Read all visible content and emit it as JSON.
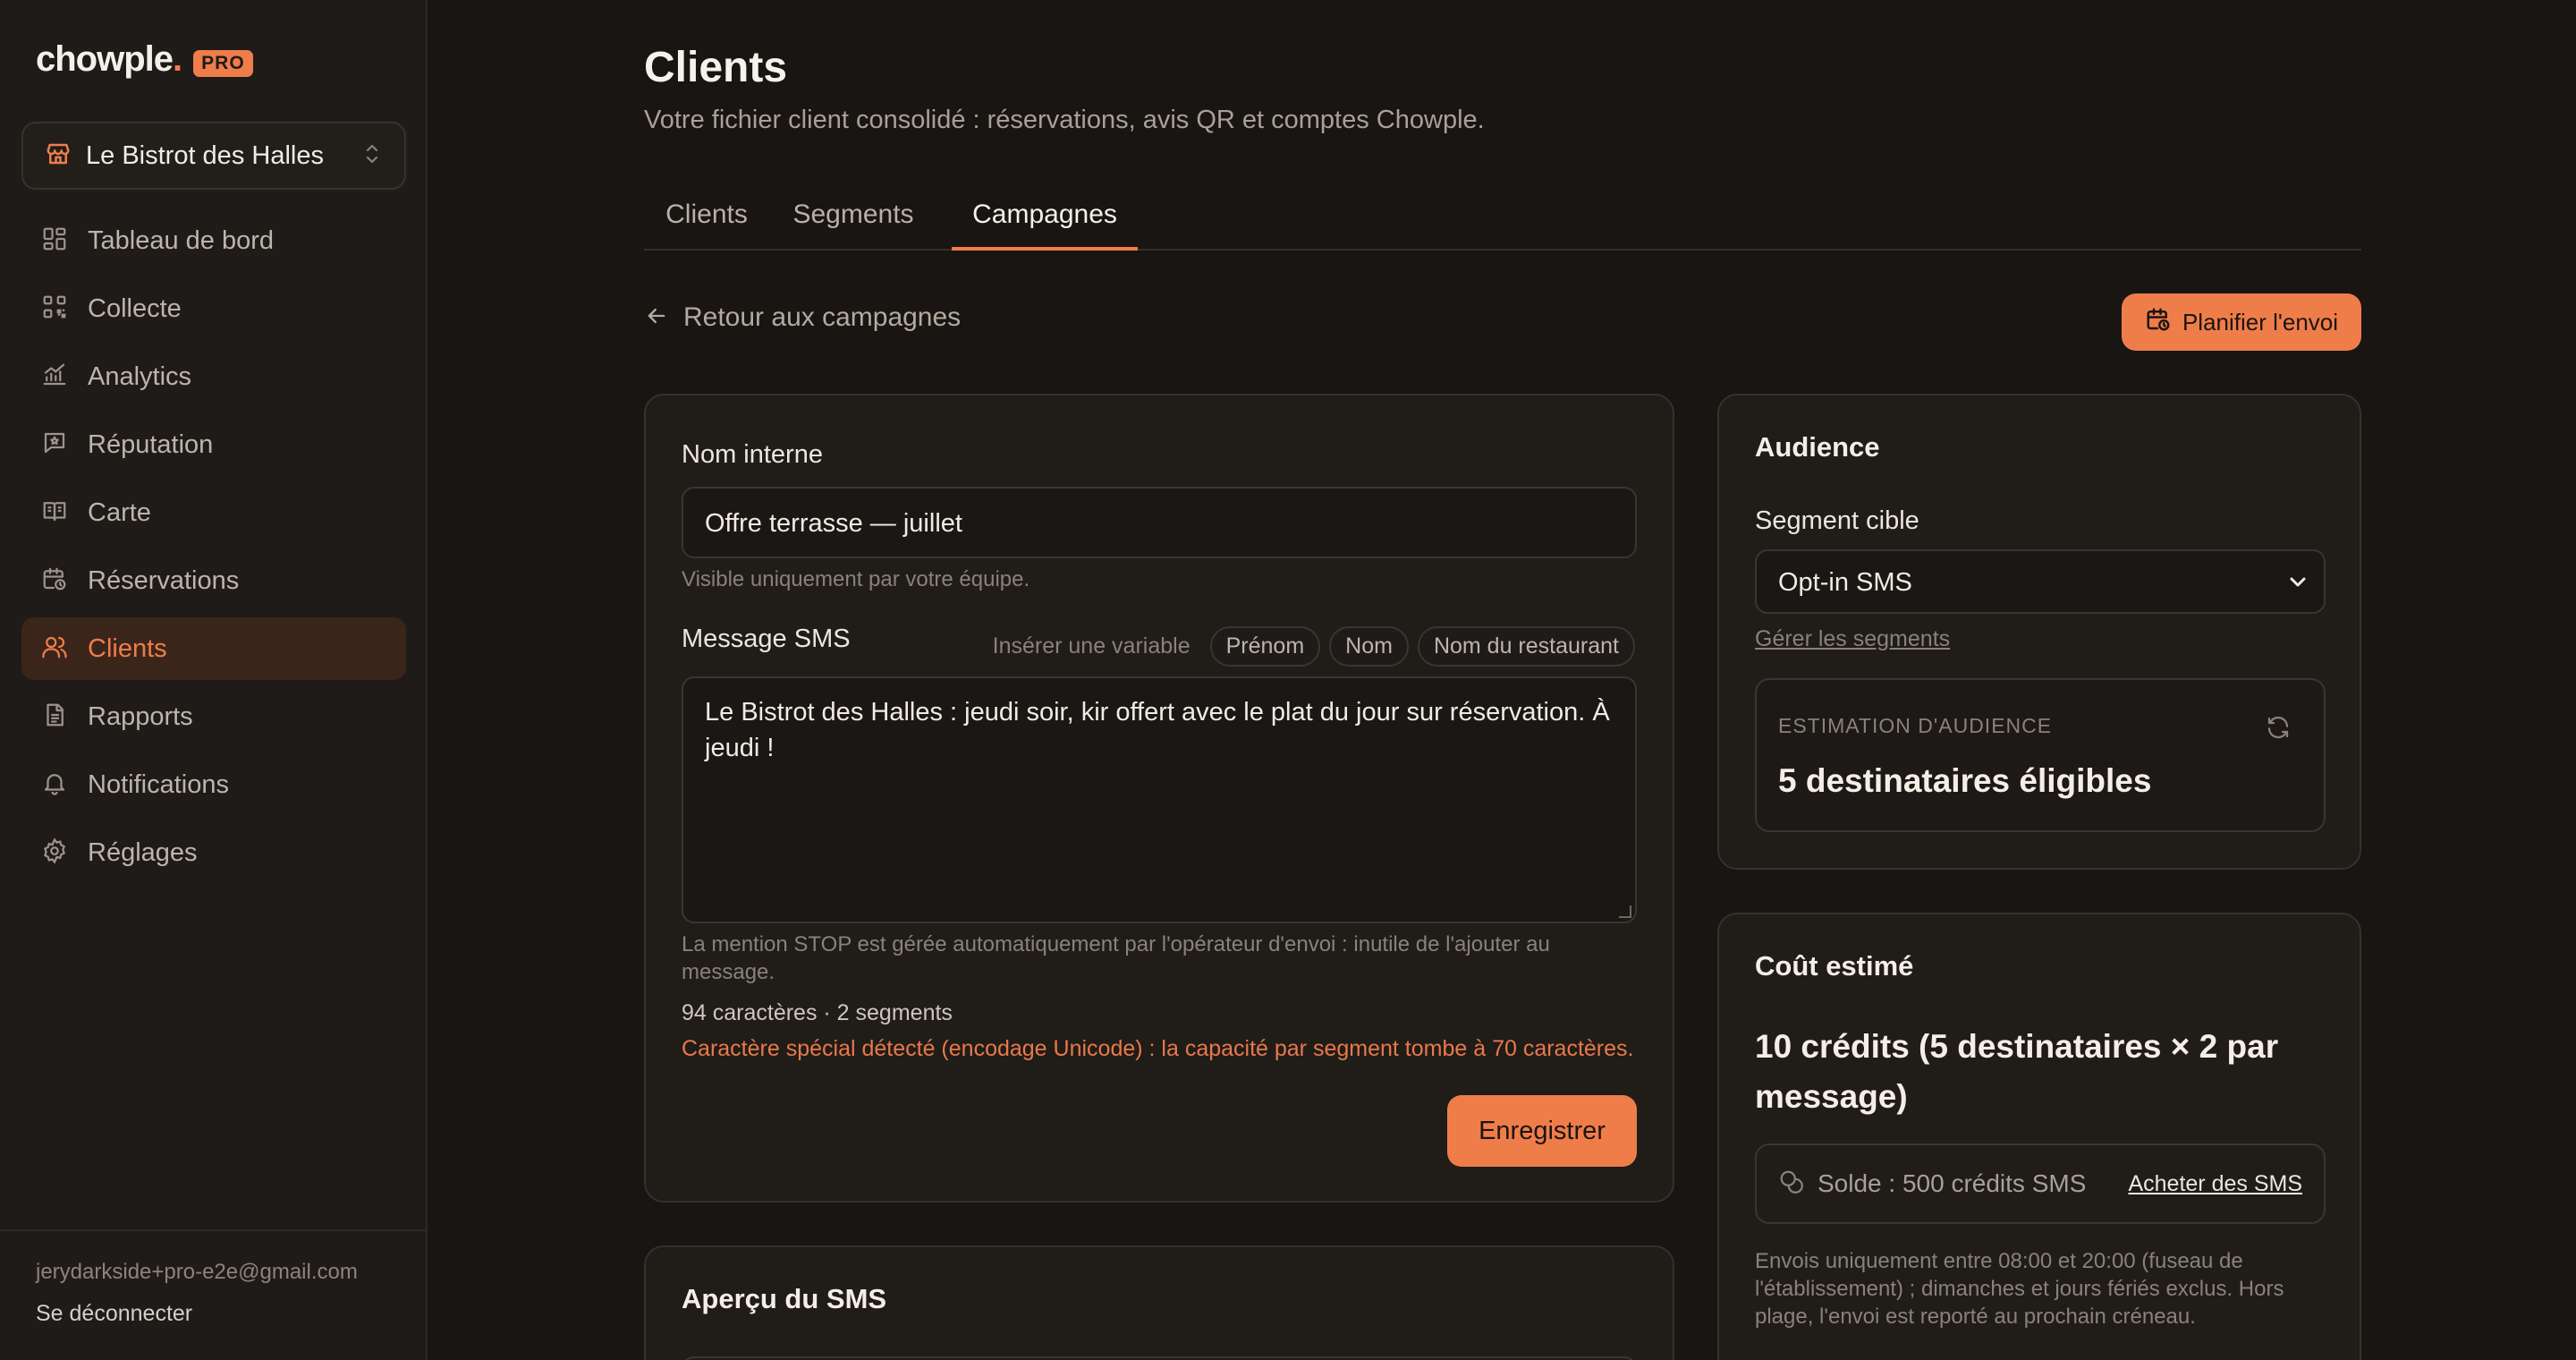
{
  "brand": {
    "name": "chowple",
    "dot": ".",
    "badge": "PRO"
  },
  "venue": {
    "name": "Le Bistrot des Halles"
  },
  "nav": [
    {
      "label": "Tableau de bord",
      "icon": "dashboard-icon"
    },
    {
      "label": "Collecte",
      "icon": "qr-code-icon"
    },
    {
      "label": "Analytics",
      "icon": "chart-icon"
    },
    {
      "label": "Réputation",
      "icon": "message-star-icon"
    },
    {
      "label": "Carte",
      "icon": "menu-book-icon"
    },
    {
      "label": "Réservations",
      "icon": "calendar-clock-icon"
    },
    {
      "label": "Clients",
      "icon": "users-icon",
      "active": true
    },
    {
      "label": "Rapports",
      "icon": "document-icon"
    },
    {
      "label": "Notifications",
      "icon": "bell-icon"
    },
    {
      "label": "Réglages",
      "icon": "gear-icon"
    }
  ],
  "user": {
    "email": "jerydarkside+pro-e2e@gmail.com",
    "logout": "Se déconnecter"
  },
  "page": {
    "title": "Clients",
    "subtitle": "Votre fichier client consolidé : réservations, avis QR et comptes Chowple."
  },
  "tabs": [
    {
      "label": "Clients"
    },
    {
      "label": "Segments"
    },
    {
      "label": "Campagnes",
      "active": true
    }
  ],
  "back": {
    "label": "Retour aux campagnes"
  },
  "schedule_button": {
    "label": "Planifier l'envoi"
  },
  "editor": {
    "name_label": "Nom interne",
    "name_value": "Offre terrasse — juillet",
    "name_help": "Visible uniquement par votre équipe.",
    "message_label": "Message SMS",
    "insert_variable_label": "Insérer une variable",
    "variables": [
      "Prénom",
      "Nom",
      "Nom du restaurant"
    ],
    "message_value": "Le Bistrot des Halles : jeudi soir, kir offert avec le plat du jour sur réservation. À jeudi !",
    "stop_help": "La mention STOP est gérée automatiquement par l'opérateur d'envoi : inutile de l'ajouter au message.",
    "counter": "94 caractères · 2 segments",
    "warning": "Caractère spécial détecté (encodage Unicode) : la capacité par segment tombe à 70 caractères.",
    "save_label": "Enregistrer"
  },
  "preview": {
    "title": "Aperçu du SMS"
  },
  "audience": {
    "title": "Audience",
    "segment_label": "Segment cible",
    "segment_value": "Opt-in SMS",
    "manage_link": "Gérer les segments",
    "estimate_label": "ESTIMATION D'AUDIENCE",
    "estimate_value": "5 destinataires éligibles"
  },
  "cost": {
    "title": "Coût estimé",
    "value": "10 crédits (5 destinataires × 2 par message)",
    "balance": "Solde : 500 crédits SMS",
    "buy_link": "Acheter des SMS",
    "note": "Envois uniquement entre 08:00 et 20:00 (fuseau de l'établissement) ; dimanches et jours fériés exclus. Hors plage, l'envoi est reporté au prochain créneau."
  },
  "colors": {
    "accent": "#ef7d4a",
    "background": "#181512",
    "sidebar": "#1f1b18",
    "card": "#201c18"
  }
}
